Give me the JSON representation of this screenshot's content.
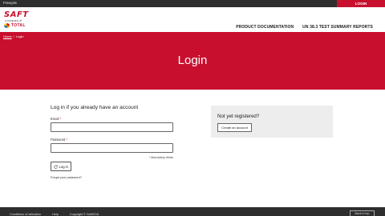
{
  "topbar": {
    "language": "Français",
    "login_label": "LOGIN"
  },
  "brand": {
    "name": "SAFT",
    "tagline": "a company of",
    "parent": "TOTAL"
  },
  "nav": {
    "items": [
      "PRODUCT DOCUMENTATION",
      "UN 38.3 TEST SUMMARY REPORTS"
    ]
  },
  "breadcrumb": {
    "home": "Home",
    "separator": "/",
    "current": "Login"
  },
  "hero": {
    "title": "Login"
  },
  "login": {
    "heading": "Log in if you already have an account",
    "email_label": "Email",
    "password_label": "Password",
    "required_mark": "*",
    "mandatory_note": "Mandatory fields",
    "submit_label": "Log in",
    "forgot_label": "Forgot your password?"
  },
  "register": {
    "heading": "Not yet registered?",
    "button_label": "Create an account"
  },
  "footer": {
    "links": [
      "Conditions of utilization",
      "Help",
      "Copyright © Saft2016"
    ],
    "back_to_top": "Back to top"
  },
  "colors": {
    "brand_red": "#c8102e",
    "dark_bar": "#2e2e2e",
    "panel_grey": "#ededed"
  }
}
